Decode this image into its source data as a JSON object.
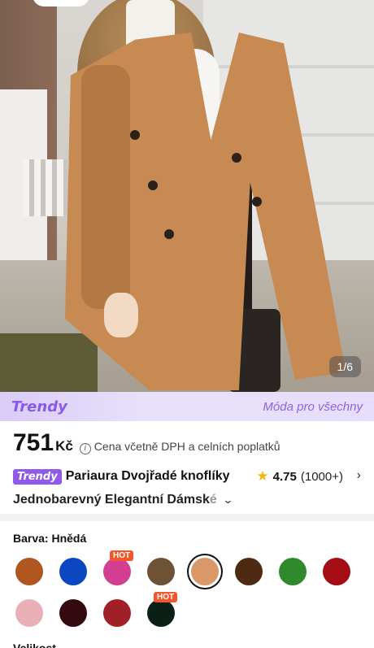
{
  "gallery": {
    "counter": "1/6"
  },
  "banner": {
    "brand": "Trendy",
    "slogan": "Móda pro všechny"
  },
  "price": {
    "amount": "751",
    "currency": "Kč",
    "note": "Cena včetně DPH a celních poplatků"
  },
  "product": {
    "badge": "Trendy",
    "title_line1": "Pariaura Dvojřadé knoflíky",
    "title_line2_main": "Jednobarevný Elegantní Dámsk",
    "title_line2_fade": "é",
    "rating": "4.75",
    "rating_count": "(1000+)"
  },
  "colors": {
    "label": "Barva: Hnědá",
    "selected_index": 4,
    "hot_label": "HOT",
    "swatches": [
      "#b0561f",
      "#0a47c0",
      "#d23f92",
      "#6d5236",
      "#d99868",
      "#4e2a12",
      "#2e8a2b",
      "#a50d14",
      "#e8b0b6",
      "#34090f",
      "#a11f26",
      "#0c1f17"
    ]
  },
  "next_section": {
    "label": "Velikost"
  }
}
